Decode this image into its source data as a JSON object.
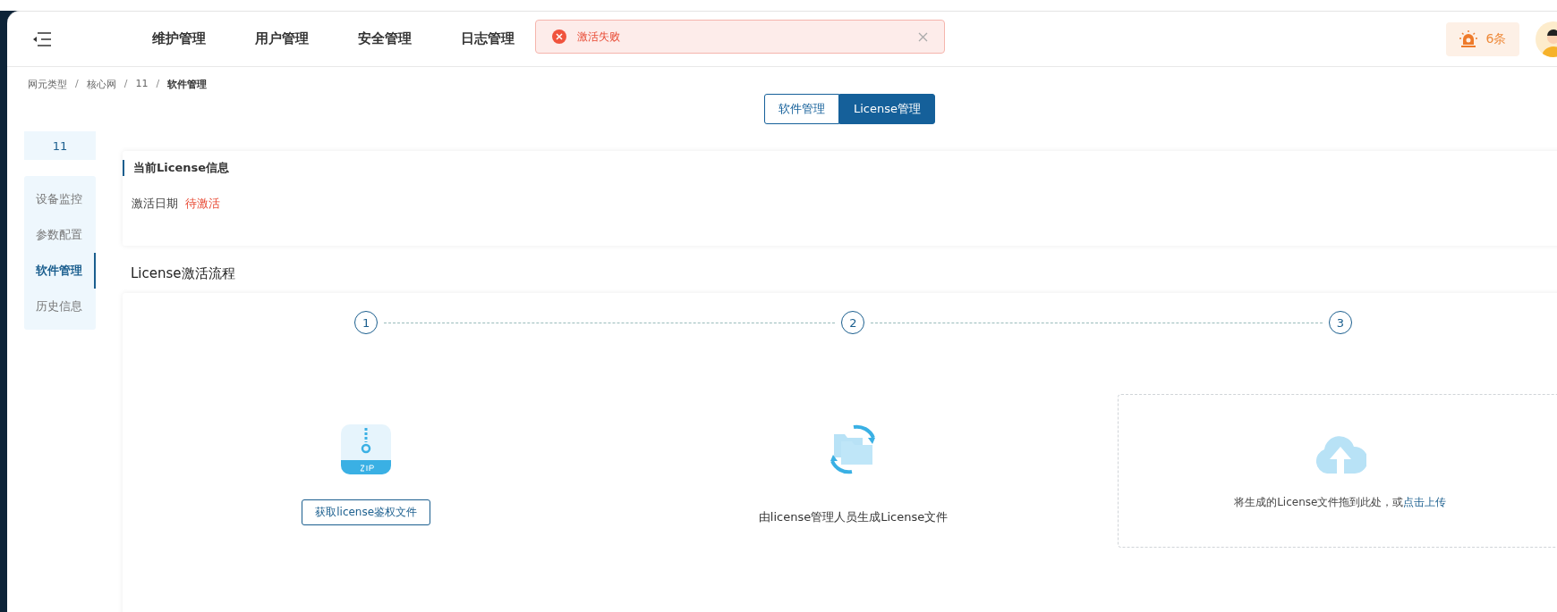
{
  "nav": [
    {
      "label": "维护管理"
    },
    {
      "label": "用户管理"
    },
    {
      "label": "安全管理"
    },
    {
      "label": "日志管理"
    }
  ],
  "toast": {
    "kind": "error",
    "message": "激活失败"
  },
  "alarm": {
    "count": "6条"
  },
  "breadcrumb": [
    {
      "label": "网元类型",
      "current": false
    },
    {
      "label": "核心网",
      "current": false
    },
    {
      "label": "11",
      "current": false
    },
    {
      "label": "软件管理",
      "current": true
    }
  ],
  "breadcrumb_separator": "/",
  "tabs": [
    {
      "label": "软件管理",
      "selected": false
    },
    {
      "label": "License管理",
      "selected": true
    }
  ],
  "sidebar": {
    "title": "11",
    "items": [
      {
        "label": "设备监控",
        "selected": false
      },
      {
        "label": "参数配置",
        "selected": false
      },
      {
        "label": "软件管理",
        "selected": true
      },
      {
        "label": "历史信息",
        "selected": false
      }
    ]
  },
  "license_info": {
    "title": "当前License信息",
    "field_label": "激活日期",
    "field_value": "待激活"
  },
  "process": {
    "title": "License激活流程",
    "steps": [
      {
        "number": "1",
        "kind": "download",
        "button": "获取license鉴权文件"
      },
      {
        "number": "2",
        "kind": "generate",
        "text": "由license管理人员生成License文件"
      },
      {
        "number": "3",
        "kind": "upload",
        "text": "将生成的License文件拖到此处，或",
        "link": "点击上传"
      }
    ]
  }
}
